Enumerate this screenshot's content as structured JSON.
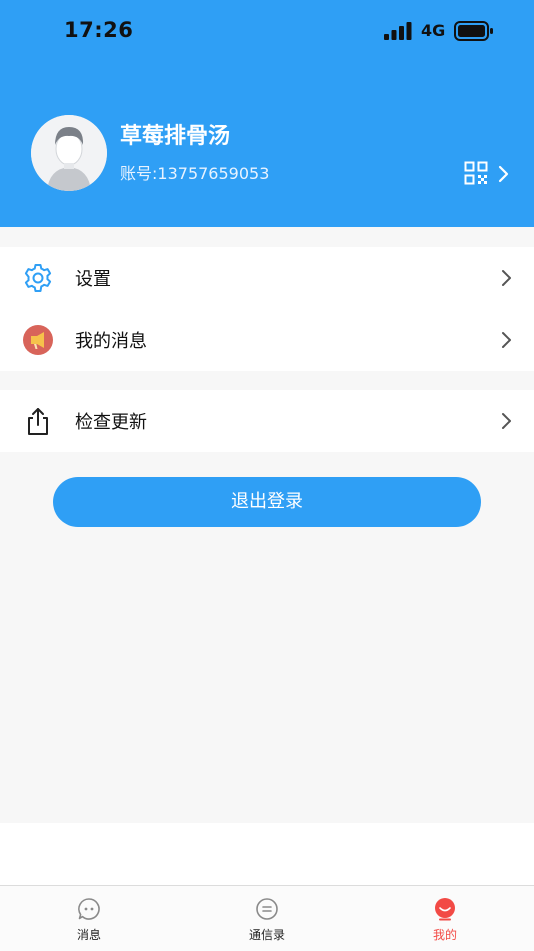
{
  "status_bar": {
    "time": "17:26",
    "network": "4G"
  },
  "profile": {
    "name": "草莓排骨汤",
    "account_label": "账号:",
    "account_number": "13757659053"
  },
  "menu": {
    "settings": "设置",
    "my_messages": "我的消息",
    "check_update": "检查更新"
  },
  "logout_label": "退出登录",
  "tabbar": {
    "messages": "消息",
    "contacts": "通信录",
    "mine": "我的"
  },
  "colors": {
    "primary": "#2f9ff5",
    "active_tab": "#f24a45"
  }
}
